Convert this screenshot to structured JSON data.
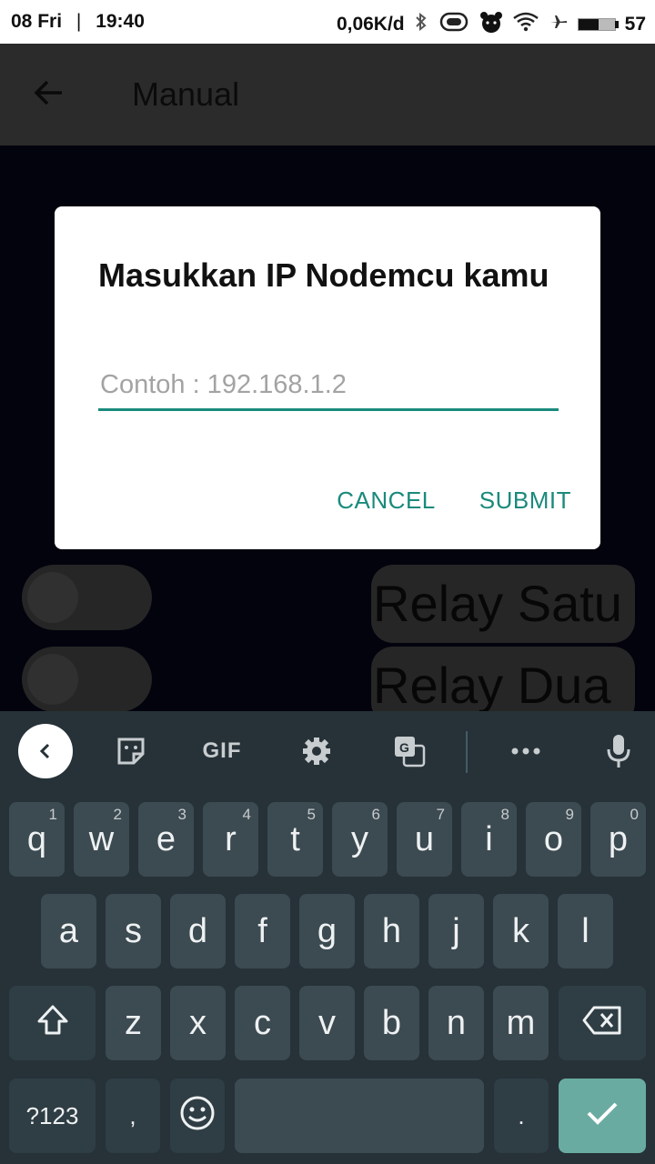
{
  "status_bar": {
    "date": "08 Fri",
    "separator": "|",
    "time": "19:40",
    "network_speed": "0,06K/d",
    "battery_level": "57",
    "icons": [
      "bluetooth-icon",
      "vibrate-icon",
      "bear-icon",
      "wifi-icon",
      "airplane-icon",
      "battery-icon"
    ]
  },
  "app_bar": {
    "title": "Manual",
    "back_icon": "arrow-left-icon"
  },
  "relays": [
    {
      "label": "Relay Satu",
      "on": false
    },
    {
      "label": "Relay Dua",
      "on": false
    }
  ],
  "dialog": {
    "title": "Masukkan IP Nodemcu kamu",
    "input_placeholder": "Contoh : 192.168.1.2",
    "input_value": "",
    "cancel_label": "CANCEL",
    "submit_label": "SUBMIT"
  },
  "keyboard": {
    "toolbar": [
      "back-icon",
      "sticker-icon",
      "GIF",
      "settings-icon",
      "translate-icon",
      "more-icon",
      "mic-icon"
    ],
    "gif_label": "GIF",
    "row1": [
      {
        "key": "q",
        "hint": "1"
      },
      {
        "key": "w",
        "hint": "2"
      },
      {
        "key": "e",
        "hint": "3"
      },
      {
        "key": "r",
        "hint": "4"
      },
      {
        "key": "t",
        "hint": "5"
      },
      {
        "key": "y",
        "hint": "6"
      },
      {
        "key": "u",
        "hint": "7"
      },
      {
        "key": "i",
        "hint": "8"
      },
      {
        "key": "o",
        "hint": "9"
      },
      {
        "key": "p",
        "hint": "0"
      }
    ],
    "row2": [
      "a",
      "s",
      "d",
      "f",
      "g",
      "h",
      "j",
      "k",
      "l"
    ],
    "row3": [
      "z",
      "x",
      "c",
      "v",
      "b",
      "n",
      "m"
    ],
    "symbols_label": "?123",
    "comma_label": ",",
    "period_label": ".",
    "colors": {
      "background": "#263238",
      "key": "#3c4a51",
      "enter": "#6aaba1",
      "accent": "#1a8a7c"
    }
  }
}
